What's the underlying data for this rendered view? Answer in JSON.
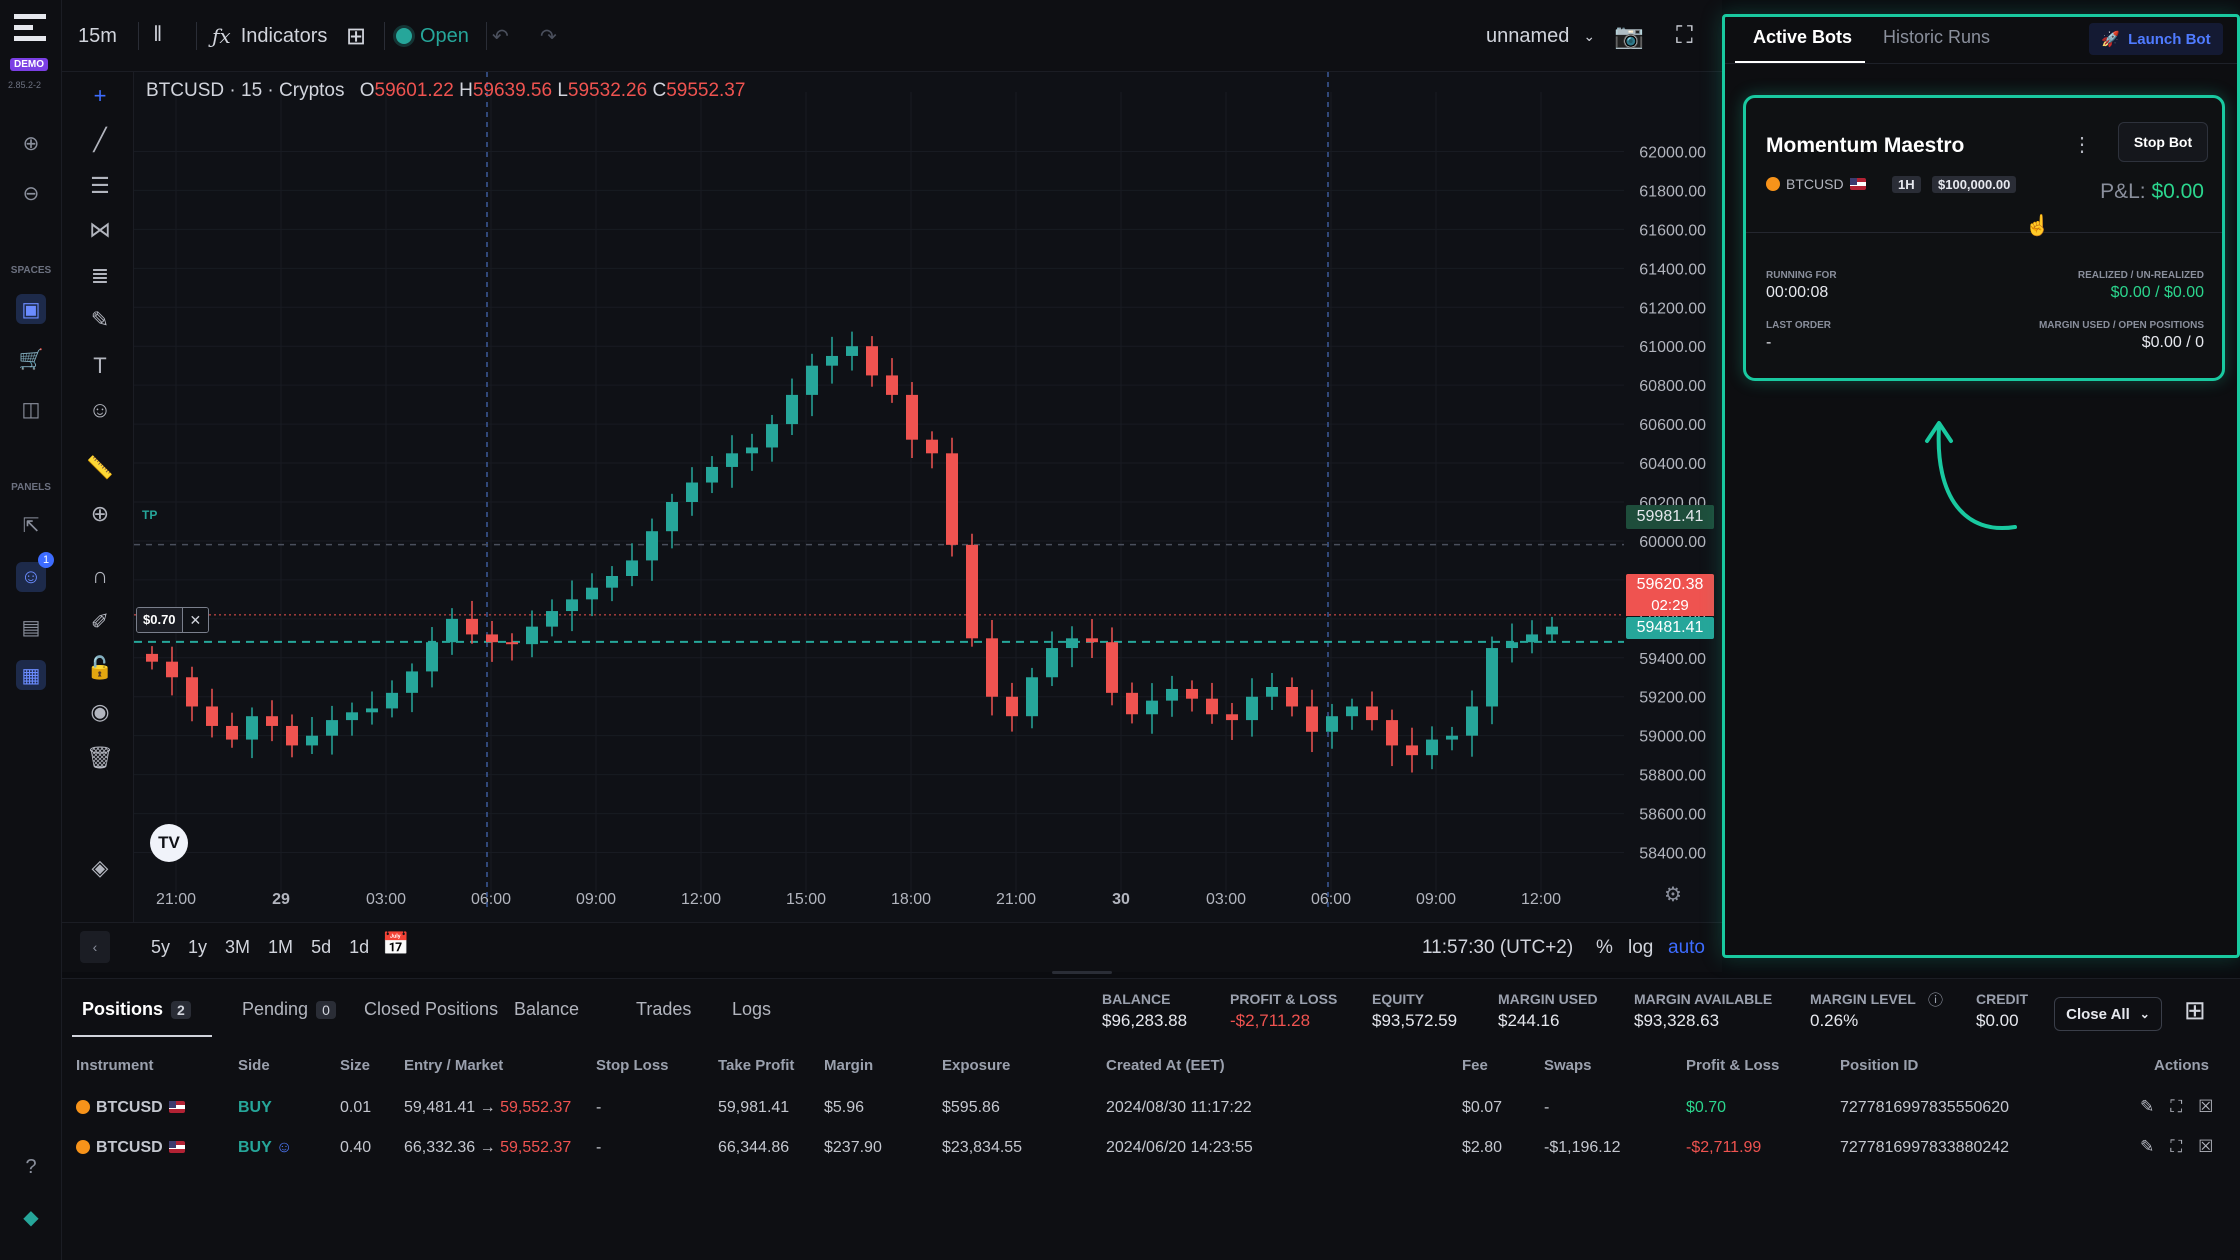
{
  "app": {
    "demo_badge": "DEMO",
    "version": "2.85.2-2",
    "spaces_label": "SPACES",
    "panels_label": "PANELS",
    "bots_badge": "1"
  },
  "toolbar": {
    "interval": "15m",
    "indicators_label": "Indicators",
    "market_status": "Open",
    "layout_name": "unnamed"
  },
  "chart": {
    "symbol": "BTCUSD · 15 · Cryptos",
    "ohlc": {
      "o_label": "O",
      "o": "59601.22",
      "h_label": "H",
      "h": "59639.56",
      "l_label": "L",
      "l": "59532.26",
      "c_label": "C",
      "c": "59552.37"
    },
    "tp_label": "TP",
    "position_tag": "$0.70",
    "position_close": "✕",
    "price_tags": {
      "tp": "59981.41",
      "last": "59620.38",
      "countdown": "02:29",
      "entry": "59481.41"
    },
    "logo": "TV",
    "colors": {
      "up": "#26a69a",
      "down": "#ef5350",
      "tp_line": "#4a4f5c",
      "entry_line": "#26a69a",
      "last_line": "#ef5350"
    }
  },
  "chart_data": {
    "type": "candlestick",
    "title": "BTCUSD · 15 · Cryptos",
    "x_ticks": [
      "21:00",
      "29",
      "03:00",
      "06:00",
      "09:00",
      "12:00",
      "15:00",
      "18:00",
      "21:00",
      "30",
      "03:00",
      "06:00",
      "09:00",
      "12:00"
    ],
    "y_ticks": [
      "62000.00",
      "61800.00",
      "61600.00",
      "61400.00",
      "61200.00",
      "61000.00",
      "60800.00",
      "60600.00",
      "60400.00",
      "60200.00",
      "60000.00",
      "59800.00",
      "59600.00",
      "59400.00",
      "59200.00",
      "59000.00",
      "58800.00",
      "58600.00",
      "58400.00"
    ],
    "ylim": [
      58300,
      62100
    ],
    "series": [
      {
        "name": "BTCUSD",
        "close": [
          59380,
          59300,
          59150,
          59050,
          58980,
          59100,
          59050,
          58950,
          59000,
          59080,
          59120,
          59140,
          59220,
          59330,
          59480,
          59600,
          59520,
          59480,
          59470,
          59560,
          59640,
          59700,
          59760,
          59820,
          59900,
          60050,
          60200,
          60300,
          60380,
          60450,
          60480,
          60600,
          60750,
          60900,
          60950,
          61000,
          60850,
          60750,
          60520,
          60450,
          59980,
          59500,
          59200,
          59100,
          59300,
          59450,
          59500,
          59480,
          59220,
          59110,
          59180,
          59240,
          59190,
          59110,
          59080,
          59200,
          59250,
          59150,
          59020,
          59100,
          59150,
          59080,
          58950,
          58900,
          58980,
          59000,
          59150,
          59450,
          59480,
          59520,
          59560
        ]
      }
    ],
    "grid": true,
    "vertical_markers": [
      "06:00",
      "06:00"
    ],
    "horizontal_levels": {
      "take_profit": 59981.41,
      "last": 59620.38,
      "entry": 59481.41
    }
  },
  "rangebar": {
    "ranges": [
      "5y",
      "1y",
      "3M",
      "1M",
      "5d",
      "1d"
    ],
    "clock": "11:57:30 (UTC+2)",
    "pct": "%",
    "log": "log",
    "auto": "auto"
  },
  "panel": {
    "tabs": [
      "Active Bots",
      "Historic Runs"
    ],
    "launch_label": "Launch Bot",
    "bot": {
      "name": "Momentum Maestro",
      "menu": "⋮",
      "stop_label": "Stop Bot",
      "symbol": "BTCUSD",
      "timeframe": "1H",
      "capital": "$100,000.00",
      "pnl_label": "P&L:",
      "pnl_value": "$0.00",
      "running_label": "RUNNING FOR",
      "running_value": "00:00:08",
      "realized_label": "REALIZED / UN-REALIZED",
      "realized_value": "$0.00 / $0.00",
      "last_order_label": "LAST ORDER",
      "last_order_value": "-",
      "margin_label": "MARGIN USED / OPEN POSITIONS",
      "margin_value": "$0.00 / 0"
    }
  },
  "bottom": {
    "tabs": [
      {
        "label": "Positions",
        "count": "2"
      },
      {
        "label": "Pending",
        "count": "0"
      },
      {
        "label": "Closed Positions"
      },
      {
        "label": "Balance"
      },
      {
        "label": "Trades"
      },
      {
        "label": "Logs"
      }
    ],
    "stats": [
      {
        "label": "BALANCE",
        "value": "$96,283.88"
      },
      {
        "label": "PROFIT & LOSS",
        "value": "-$2,711.28"
      },
      {
        "label": "EQUITY",
        "value": "$93,572.59"
      },
      {
        "label": "MARGIN USED",
        "value": "$244.16"
      },
      {
        "label": "MARGIN AVAILABLE",
        "value": "$93,328.63"
      },
      {
        "label": "MARGIN LEVEL",
        "value": "0.26%"
      },
      {
        "label": "CREDIT",
        "value": "$0.00"
      }
    ],
    "close_all": "Close All",
    "columns": [
      "Instrument",
      "Side",
      "Size",
      "Entry / Market",
      "Stop Loss",
      "Take Profit",
      "Margin",
      "Exposure",
      "Created At (EET)",
      "Fee",
      "Swaps",
      "Profit & Loss",
      "Position ID",
      "Actions"
    ],
    "rows": [
      {
        "instrument": "BTCUSD",
        "side": "BUY",
        "size": "0.01",
        "entry": "59,481.41",
        "market": "59,552.37",
        "sl": "-",
        "tp": "59,981.41",
        "margin": "$5.96",
        "exposure": "$595.86",
        "created": "2024/08/30 11:17:22",
        "fee": "$0.07",
        "swaps": "-",
        "pnl": "$0.70",
        "pid": "7277816997835550620"
      },
      {
        "instrument": "BTCUSD",
        "side": "BUY",
        "size": "0.40",
        "entry": "66,332.36",
        "market": "59,552.37",
        "sl": "-",
        "tp": "66,344.86",
        "margin": "$237.90",
        "exposure": "$23,834.55",
        "created": "2024/06/20 14:23:55",
        "fee": "$2.80",
        "swaps": "-$1,196.12",
        "pnl": "-$2,711.99",
        "pid": "7277816997833880242"
      }
    ]
  }
}
